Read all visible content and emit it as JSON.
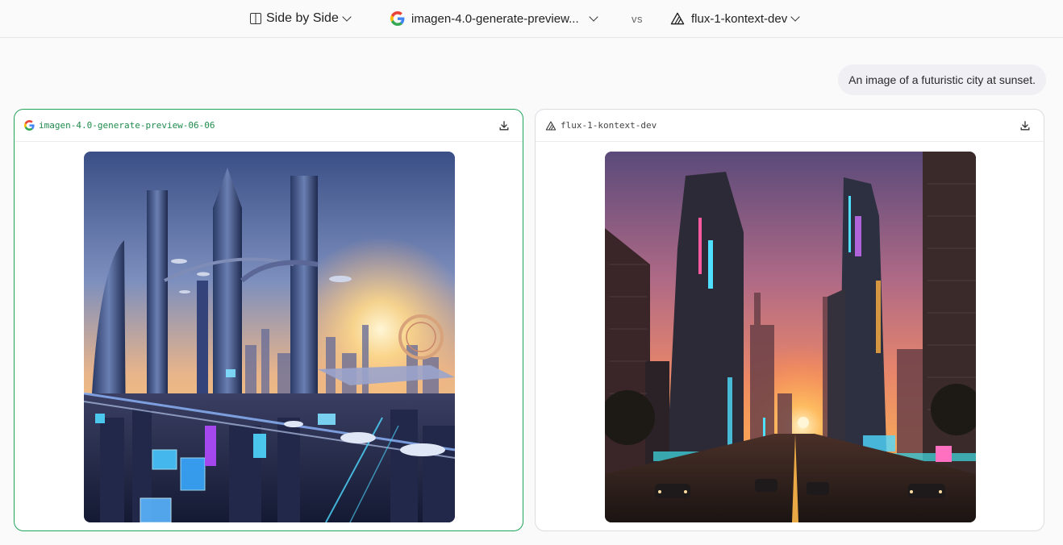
{
  "topbar": {
    "mode_label": "Side by Side",
    "model_a": "imagen-4.0-generate-preview...",
    "vs_label": "vs",
    "model_b": "flux-1-kontext-dev"
  },
  "prompt": "An image of a futuristic city at sunset.",
  "panels": {
    "left": {
      "model": "imagen-4.0-generate-preview-06-06",
      "image_alt": "Futuristic city skyline at sunset with flying vehicles and holographic signs"
    },
    "right": {
      "model": "flux-1-kontext-dev",
      "image_alt": "City street lined with neon-lit towers at sunset"
    }
  },
  "icons": {
    "mode": "split-view-icon",
    "model_a": "google-logo-icon",
    "model_b": "flux-triangle-icon",
    "download": "download-icon",
    "chevron": "chevron-down-icon"
  },
  "colors": {
    "selected_border": "#22a35a",
    "selected_text": "#1f8b4c"
  }
}
